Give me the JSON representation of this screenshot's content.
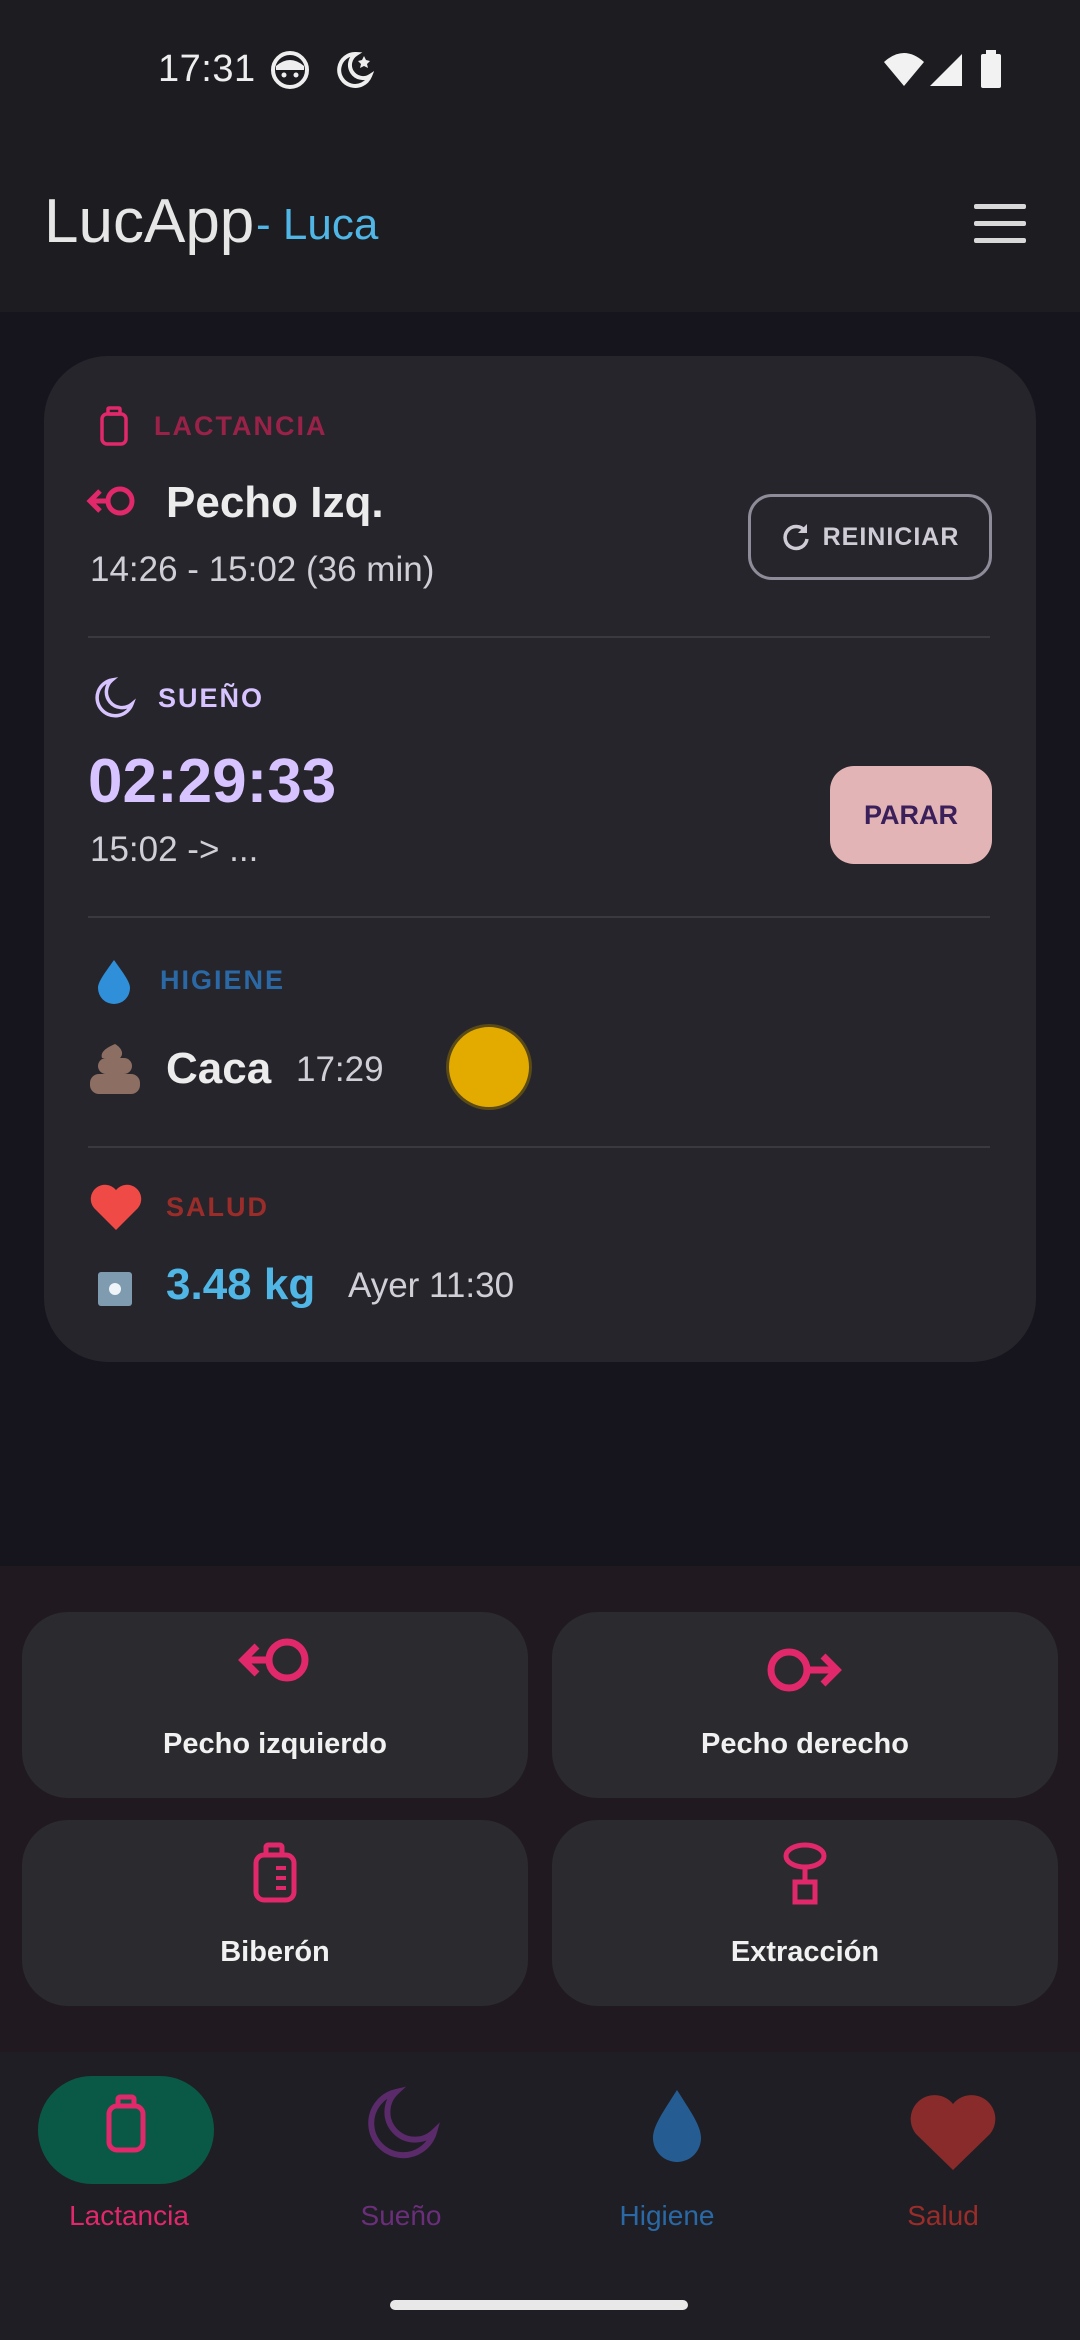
{
  "status_bar": {
    "time": "17:31"
  },
  "app_bar": {
    "title": "LucApp",
    "subtitle": "- Luca",
    "menu_icon": "hamburger-menu-icon"
  },
  "colors": {
    "lactancia": "#e0286a",
    "sueno": "#d7c3ff",
    "higiene": "#2f8fd9",
    "salud": "#ef4a45",
    "accent_blue": "#4fb6e6"
  },
  "summary": {
    "lactancia": {
      "label": "LACTANCIA",
      "side": "Pecho Izq.",
      "range": "14:26 - 15:02 (36 min)",
      "restart_label": "REINICIAR"
    },
    "sueno": {
      "label": "SUEÑO",
      "timer": "02:29:33",
      "range": "15:02 -> ...",
      "stop_label": "PARAR"
    },
    "higiene": {
      "label": "HIGIENE",
      "type": "Caca",
      "time": "17:29",
      "color_swatch": "#e3ab00"
    },
    "salud": {
      "label": "SALUD",
      "weight": "3.48 kg",
      "time": "Ayer 11:30"
    }
  },
  "actions": [
    {
      "label": "Pecho izquierdo",
      "icon": "left-breast-icon"
    },
    {
      "label": "Pecho derecho",
      "icon": "right-breast-icon"
    },
    {
      "label": "Biberón",
      "icon": "bottle-icon"
    },
    {
      "label": "Extracción",
      "icon": "pump-icon"
    }
  ],
  "nav": [
    {
      "label": "Lactancia",
      "icon": "bottle-icon",
      "active": true
    },
    {
      "label": "Sueño",
      "icon": "moon-icon",
      "active": false
    },
    {
      "label": "Higiene",
      "icon": "drop-icon",
      "active": false
    },
    {
      "label": "Salud",
      "icon": "heart-icon",
      "active": false
    }
  ]
}
